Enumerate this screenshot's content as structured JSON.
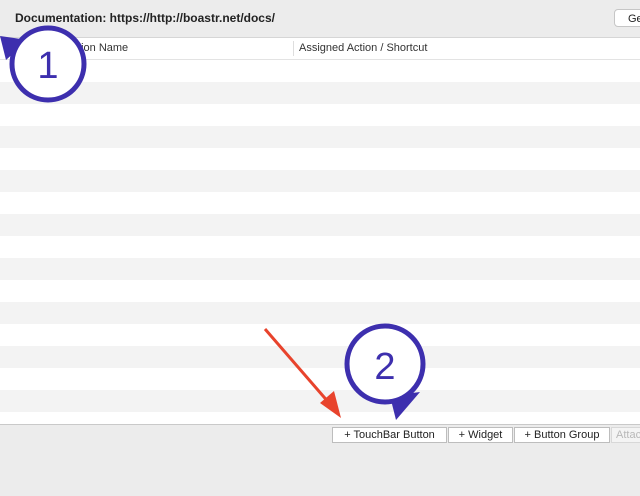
{
  "header": {
    "documentation_label": "Documentation: https://http://boastr.net/docs/",
    "get_button_label": "Ge"
  },
  "table": {
    "columns": [
      "TouchBar Action Name",
      "Assigned Action / Shortcut"
    ],
    "column_name_visible": "chBar Action Name",
    "rows_count_visible": 17
  },
  "footer": {
    "buttons": [
      "+ TouchBar Button",
      "+ Widget",
      "+ Button Group",
      "Attac"
    ]
  },
  "annotations": {
    "badge_1": "1",
    "badge_2": "2",
    "badge_color": "#3d2fae",
    "arrow_color": "#e8432c"
  }
}
